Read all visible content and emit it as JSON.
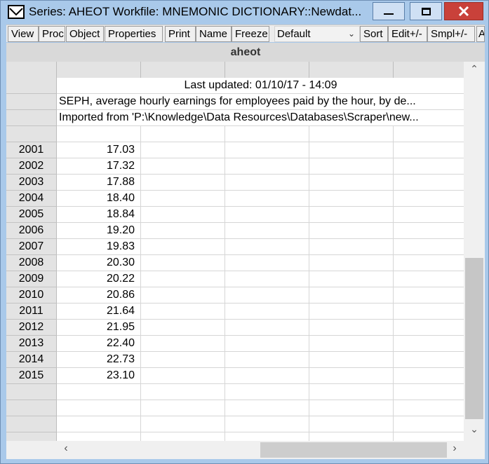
{
  "window": {
    "title": "Series: AHEOT   Workfile: MNEMONIC DICTIONARY::Newdat...",
    "accent": "#a9c9ea",
    "controls": {
      "minimize": "minimize-icon",
      "maximize": "maximize-icon",
      "close": "close-icon"
    }
  },
  "toolbar": {
    "view": "View",
    "proc": "Proc",
    "object": "Object",
    "properties": "Properties",
    "print": "Print",
    "name": "Name",
    "freeze": "Freeze",
    "display_mode": "Default",
    "sort": "Sort",
    "edit": "Edit+/-",
    "smpl": "Smpl+/-",
    "overflow": "A"
  },
  "series": {
    "name": "aheot",
    "last_updated": "Last updated: 01/10/17 - 14:09",
    "description": "SEPH, average hourly earnings for employees paid by the hour, by de...",
    "source": "Imported from 'P:\\Knowledge\\Data Resources\\Databases\\Scraper\\new..."
  },
  "rows": [
    {
      "year": "2001",
      "value": "17.03"
    },
    {
      "year": "2002",
      "value": "17.32"
    },
    {
      "year": "2003",
      "value": "17.88"
    },
    {
      "year": "2004",
      "value": "18.40"
    },
    {
      "year": "2005",
      "value": "18.84"
    },
    {
      "year": "2006",
      "value": "19.20"
    },
    {
      "year": "2007",
      "value": "19.83"
    },
    {
      "year": "2008",
      "value": "20.30"
    },
    {
      "year": "2009",
      "value": "20.22"
    },
    {
      "year": "2010",
      "value": "20.86"
    },
    {
      "year": "2011",
      "value": "21.64"
    },
    {
      "year": "2012",
      "value": "21.95"
    },
    {
      "year": "2013",
      "value": "22.40"
    },
    {
      "year": "2014",
      "value": "22.73"
    },
    {
      "year": "2015",
      "value": "23.10"
    }
  ]
}
